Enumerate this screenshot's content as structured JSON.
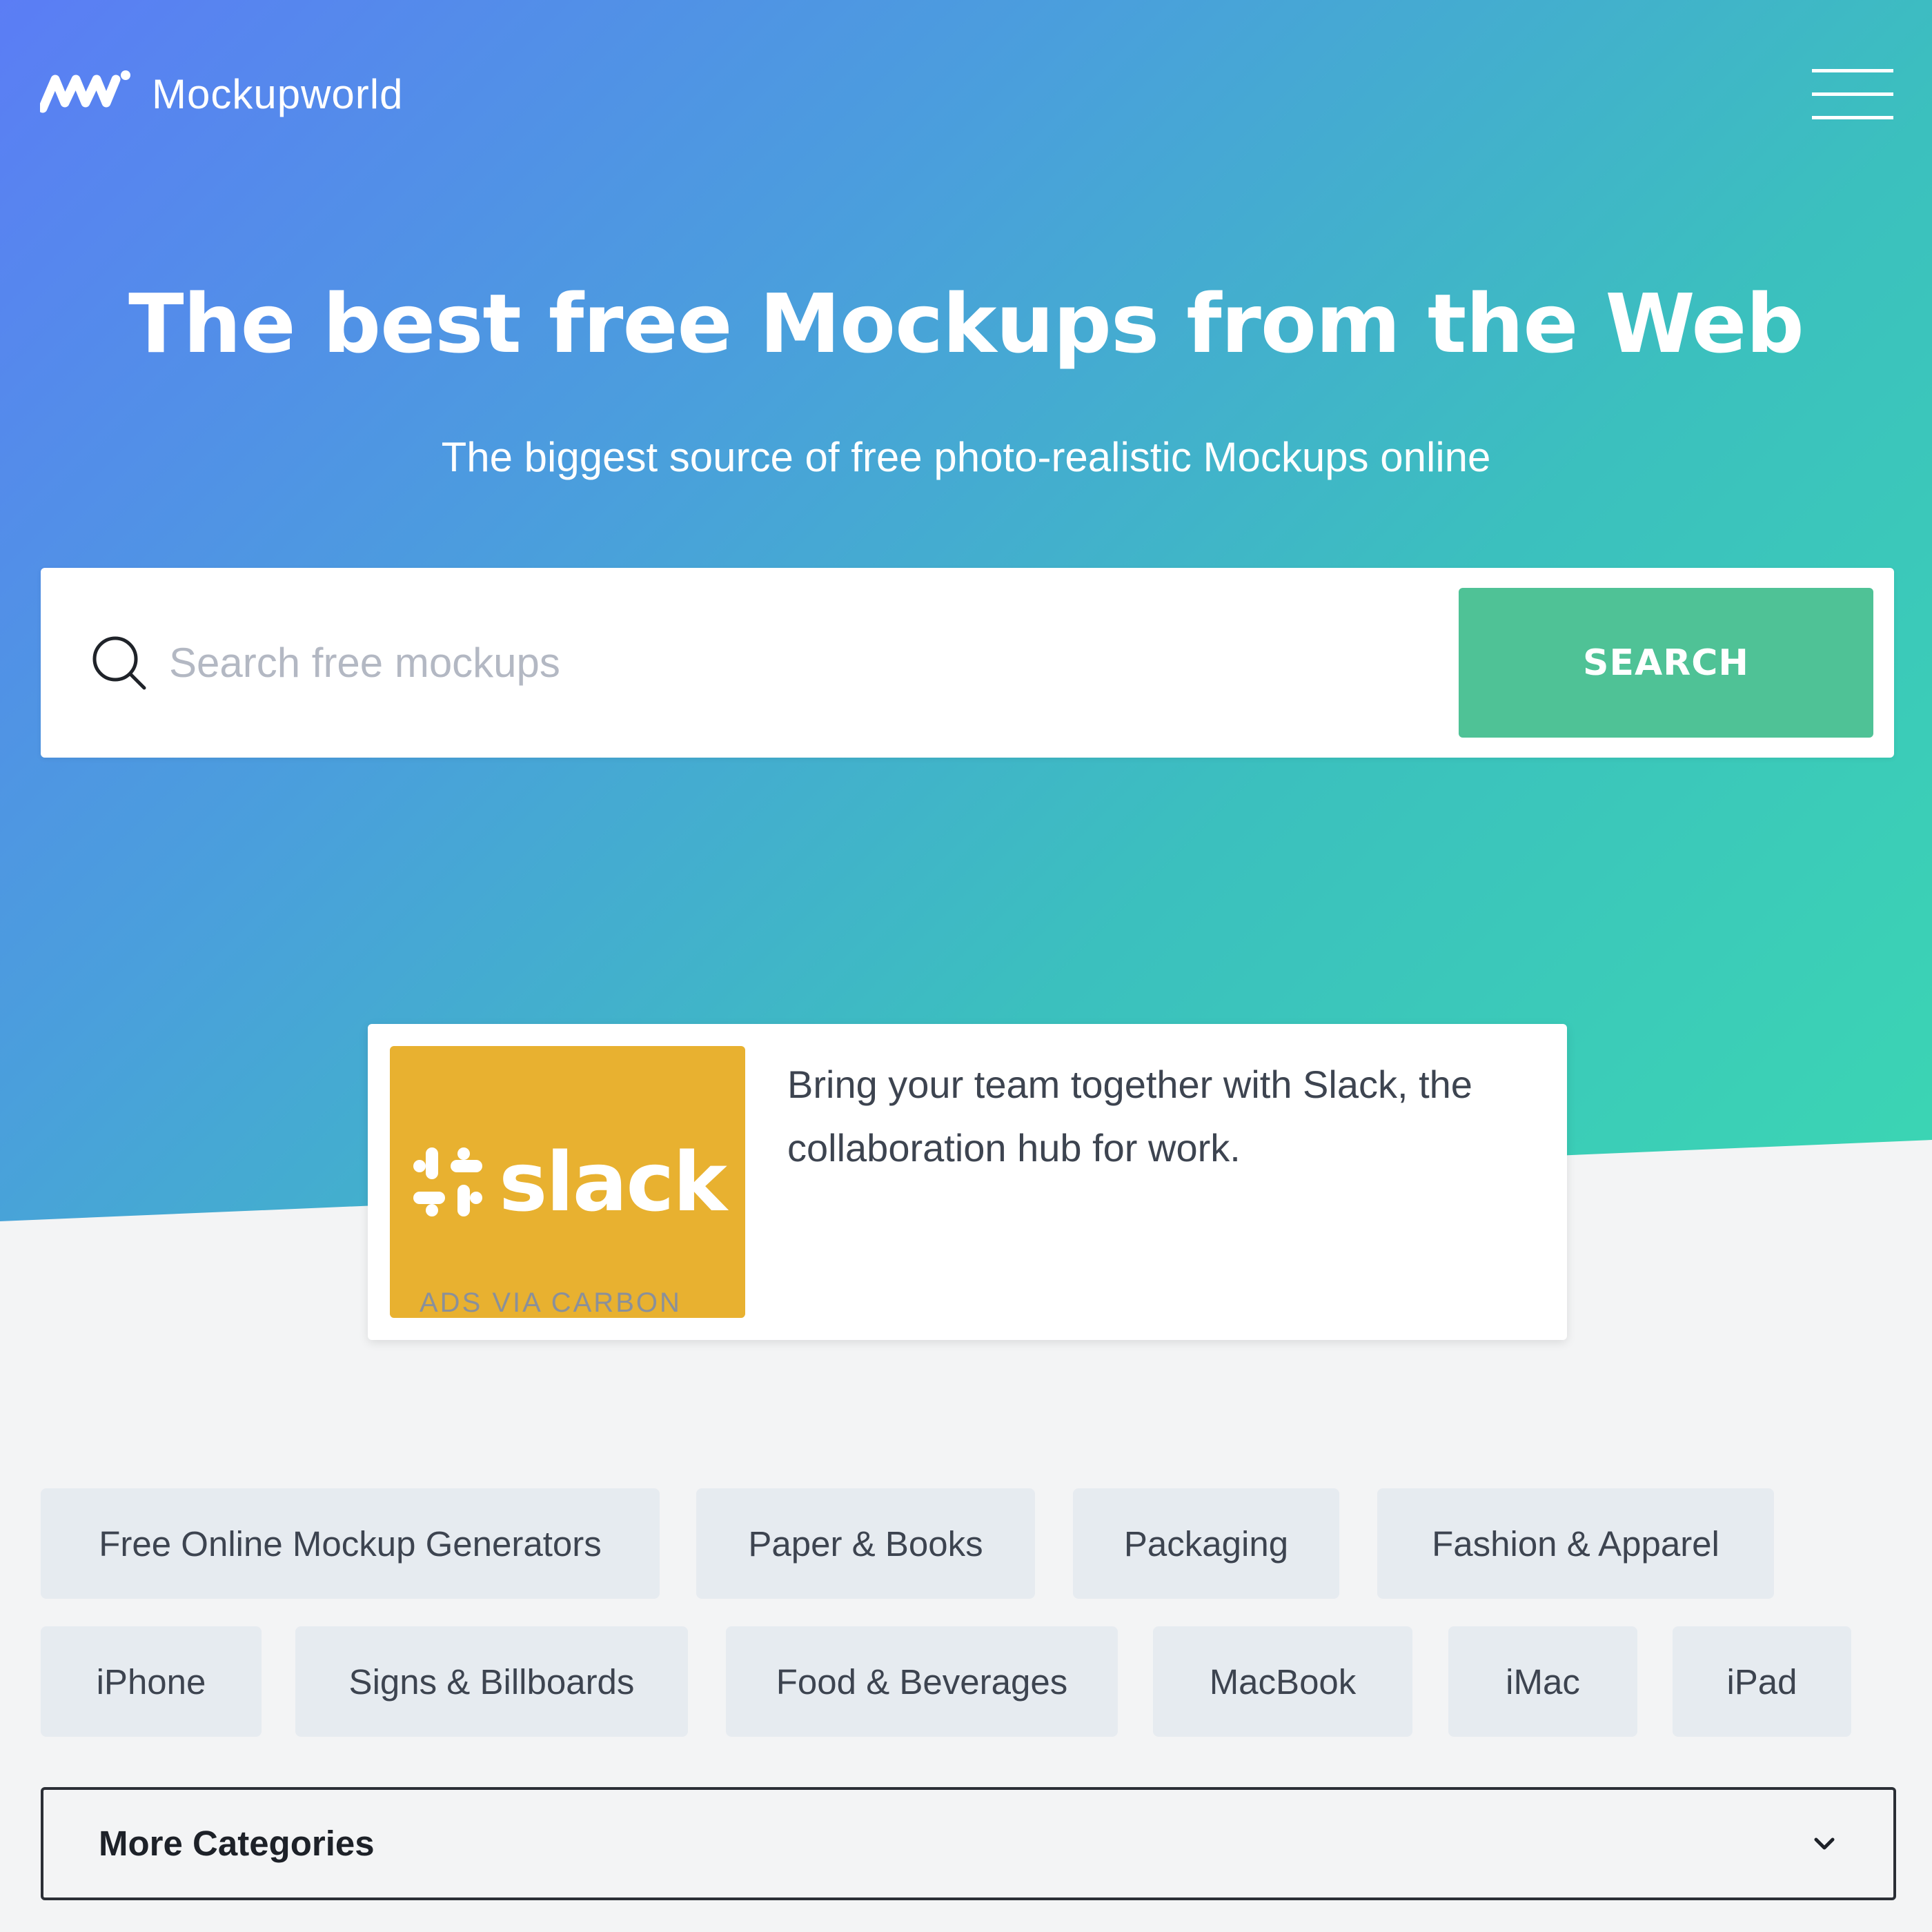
{
  "header": {
    "brand": "Mockupworld"
  },
  "hero": {
    "title": "The best free Mockups from the Web",
    "subtitle": "The biggest source of free photo-realistic Mockups online"
  },
  "search": {
    "placeholder": "Search free mockups",
    "value": "",
    "button_label": "SEARCH"
  },
  "ad": {
    "brand_word": "slack",
    "text": "Bring your team together with Slack, the collaboration hub for work.",
    "via": "ADS VIA CARBON"
  },
  "categories": {
    "row1": [
      "Free Online Mockup Generators",
      "Paper & Books",
      "Packaging",
      "Fashion & Apparel"
    ],
    "row2": [
      "iPhone",
      "Signs & Billboards",
      "Food & Beverages",
      "MacBook",
      "iMac",
      "iPad"
    ]
  },
  "more_categories": {
    "label": "More Categories"
  },
  "colors": {
    "gradient_start": "#5b7df5",
    "gradient_end": "#3bd6b3",
    "search_button": "#4fc296",
    "ad_image_bg": "#e8b130",
    "chip_bg": "#e6ebf0",
    "page_bg": "#f3f4f5"
  },
  "icons": {
    "logo": "mockupworld-logo-icon",
    "menu": "hamburger-menu-icon",
    "search": "search-icon",
    "slack": "slack-logo-icon",
    "dropdown": "chevron-down-icon"
  }
}
